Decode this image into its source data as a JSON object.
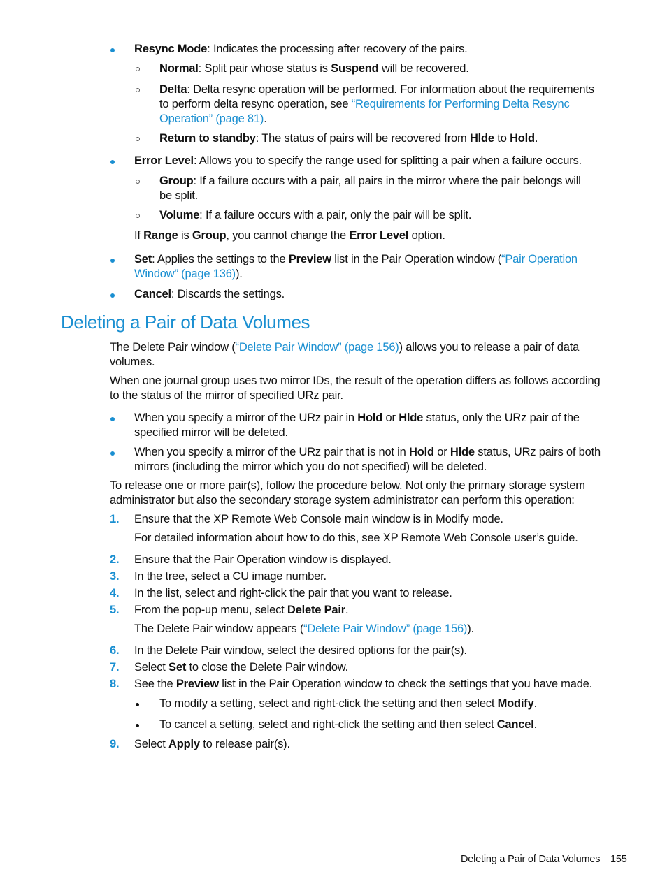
{
  "top_list": {
    "resync": {
      "term": "Resync Mode",
      "text": ": Indicates the processing after recovery of the pairs.",
      "sub": {
        "normal": {
          "term": "Normal",
          "t1": ": Split pair whose status is ",
          "b1": "Suspend",
          "t2": " will be recovered."
        },
        "delta": {
          "term": "Delta",
          "t1": ": Delta resync operation will be performed. For information about the requirements",
          "t2": "to perform delta resync operation, see ",
          "link1": "“Requirements for Performing Delta Resync",
          "link2": "Operation” (page 81)",
          "t3": "."
        },
        "standby": {
          "term": "Return to standby",
          "t1": ": The status of pairs will be recovered from ",
          "b1": "Hlde",
          "t2": " to ",
          "b2": "Hold",
          "t3": "."
        }
      }
    },
    "error_level": {
      "term": "Error Level",
      "text": ": Allows you to specify the range used for splitting a pair when a failure occurs.",
      "sub": {
        "group": {
          "term": "Group",
          "t1": ": If a failure occurs with a pair, all pairs in the mirror where the pair belongs will",
          "t2": "be split."
        },
        "volume": {
          "term": "Volume",
          "t1": ": If a failure occurs with a pair, only the pair will be split."
        }
      },
      "note": {
        "t1": "If ",
        "b1": "Range",
        "t2": " is ",
        "b2": "Group",
        "t3": ", you cannot change the ",
        "b3": "Error Level",
        "t4": " option."
      }
    },
    "set": {
      "term": "Set",
      "t1": ": Applies the settings to the ",
      "b1": "Preview",
      "t2": " list in the Pair Operation window (",
      "link1": "“Pair Operation",
      "link2": "Window” (page 136)",
      "t3": ")."
    },
    "cancel": {
      "term": "Cancel",
      "t1": ": Discards the settings."
    }
  },
  "section": {
    "title": "Deleting a Pair of Data Volumes",
    "p1": {
      "t1": "The Delete Pair window (",
      "link": "“Delete Pair Window” (page 156)",
      "t2": ") allows you to release a pair of data",
      "t3": "volumes."
    },
    "p2": {
      "l1": "When one journal group uses two mirror IDs, the result of the operation differs as follows according",
      "l2": "to the status of the mirror of specified URz pair."
    },
    "bullets": [
      {
        "t1": "When you specify a mirror of the URz pair in ",
        "b1": "Hold",
        "t2": " or ",
        "b2": "Hlde",
        "t3": " status, only the URz pair of the",
        "t4": "specified mirror will be deleted."
      },
      {
        "t1": "When you specify a mirror of the URz pair that is not in ",
        "b1": "Hold",
        "t2": " or ",
        "b2": "Hlde",
        "t3": " status, URz pairs of both",
        "t4": "mirrors (including the mirror which you do not specified) will be deleted."
      }
    ],
    "p3": {
      "l1": "To release one or more pair(s), follow the procedure below. Not only the primary storage system",
      "l2": "administrator but also the secondary storage system administrator can perform this operation:"
    },
    "steps": [
      {
        "n": "1.",
        "text": "Ensure that the XP Remote Web Console main window is in Modify mode.",
        "sub": "For detailed information about how to do this, see XP Remote Web Console user’s guide."
      },
      {
        "n": "2.",
        "text": "Ensure that the Pair Operation window is displayed."
      },
      {
        "n": "3.",
        "text": "In the tree, select a CU image number."
      },
      {
        "n": "4.",
        "text": "In the list, select and right-click the pair that you want to release."
      },
      {
        "n": "5.",
        "t1": "From the pop-up menu, select ",
        "b1": "Delete Pair",
        "t2": ".",
        "sub_t1": "The Delete Pair window appears (",
        "sub_link": "“Delete Pair Window” (page 156)",
        "sub_t2": ")."
      },
      {
        "n": "6.",
        "text": "In the Delete Pair window, select the desired options for the pair(s)."
      },
      {
        "n": "7.",
        "t1": "Select ",
        "b1": "Set",
        "t2": " to close the Delete Pair window."
      },
      {
        "n": "8.",
        "t1": "See the ",
        "b1": "Preview",
        "t2": " list in the Pair Operation window to check the settings that you have made.",
        "bullets": [
          {
            "t1": "To modify a setting, select and right-click the setting and then select ",
            "b1": "Modify",
            "t2": "."
          },
          {
            "t1": "To cancel a setting, select and right-click the setting and then select ",
            "b1": "Cancel",
            "t2": "."
          }
        ]
      },
      {
        "n": "9.",
        "t1": "Select ",
        "b1": "Apply",
        "t2": " to release pair(s)."
      }
    ]
  },
  "footer": {
    "section": "Deleting a Pair of Data Volumes",
    "page": "155"
  }
}
